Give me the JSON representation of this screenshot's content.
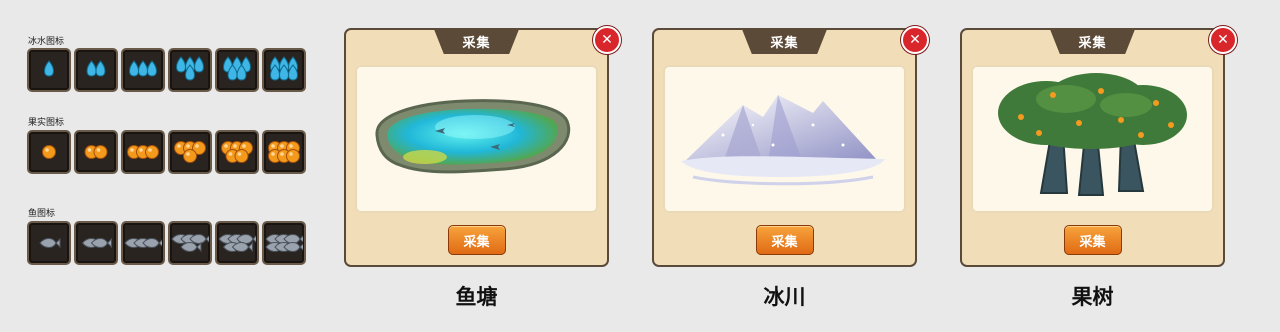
{
  "icon_groups": [
    {
      "label": "冰水图标",
      "icon": "water-drop-icon",
      "counts": [
        1,
        2,
        3,
        4,
        5,
        6
      ],
      "color": "#3fb6e6"
    },
    {
      "label": "果实图标",
      "icon": "orange-fruit-icon",
      "counts": [
        1,
        2,
        3,
        4,
        5,
        6
      ],
      "color": "#f39a1c"
    },
    {
      "label": "鱼图标",
      "icon": "fish-icon",
      "counts": [
        1,
        2,
        3,
        4,
        5,
        6
      ],
      "color": "#9aa3ad"
    }
  ],
  "panels": [
    {
      "tab_title": "采集",
      "button_label": "采集",
      "caption": "鱼塘",
      "scene": "pond-scene"
    },
    {
      "tab_title": "采集",
      "button_label": "采集",
      "caption": "冰川",
      "scene": "glacier-scene"
    },
    {
      "tab_title": "采集",
      "button_label": "采集",
      "caption": "果树",
      "scene": "fruit-tree-scene"
    }
  ],
  "close_symbol": "✕",
  "colors": {
    "panel_bg": "#f1ddb8",
    "panel_border": "#5a4a3a",
    "button_orange": "#ef8424",
    "close_red": "#d8262b"
  }
}
